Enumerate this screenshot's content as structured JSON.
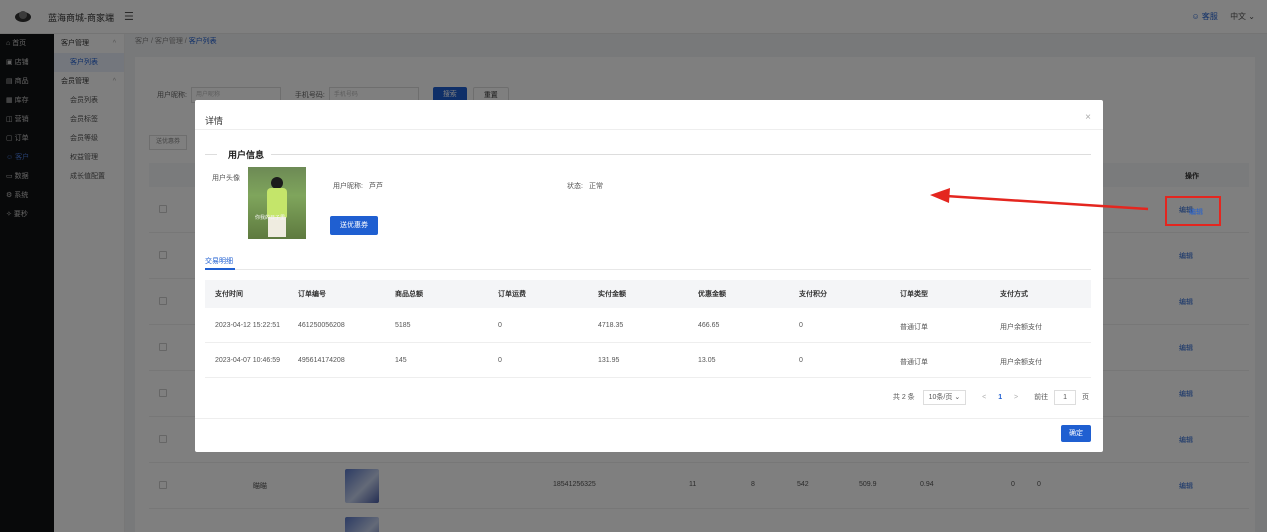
{
  "app": {
    "brand": "蓝海商城-商家端",
    "service": "客服",
    "language": "中文"
  },
  "sidebar": [
    {
      "icon": "home-icon",
      "label": "首页"
    },
    {
      "icon": "store-icon",
      "label": "店铺"
    },
    {
      "icon": "goods-icon",
      "label": "商品"
    },
    {
      "icon": "inventory-icon",
      "label": "库存"
    },
    {
      "icon": "marketing-icon",
      "label": "营销"
    },
    {
      "icon": "order-icon",
      "label": "订单"
    },
    {
      "icon": "customer-icon",
      "label": "客户",
      "active": true
    },
    {
      "icon": "data-icon",
      "label": "数据"
    },
    {
      "icon": "system-icon",
      "label": "系统"
    },
    {
      "icon": "help-icon",
      "label": "要秒"
    }
  ],
  "subsidebar": {
    "group1": "客户管理",
    "group1_items": [
      "客户列表"
    ],
    "group2": "会员管理",
    "group2_items": [
      "会员列表",
      "会员标签",
      "会员等级",
      "权益管理",
      "成长值配置"
    ]
  },
  "breadcrumb": {
    "items": [
      "客户",
      "客户管理",
      "客户列表"
    ]
  },
  "filters": {
    "nickname_label": "用户昵称:",
    "nickname_placeholder": "用户昵称",
    "phone_label": "手机号码:",
    "phone_placeholder": "手机号码",
    "search": "搜索",
    "reset": "重置"
  },
  "background": {
    "send_coupon": "送优惠券",
    "op_header": "操作",
    "edit": "编辑",
    "row_nickname": "瞄瞄",
    "row_phone": "18541256325",
    "row_values": [
      "11",
      "8",
      "542",
      "509.9",
      "0.94",
      "0",
      "0"
    ]
  },
  "dialog": {
    "title": "详情",
    "close": "×",
    "section": "用户信息",
    "avatar_label": "用户头像",
    "avatar_caption": "你我的日子里",
    "nickname_label": "用户昵称:",
    "nickname": "芦芦",
    "status_label": "状态:",
    "status": "正常",
    "coupon_button": "送优惠券",
    "tab": "交易明细",
    "columns": [
      "支付时间",
      "订单编号",
      "商品总额",
      "订单运费",
      "实付金额",
      "优惠金额",
      "支付积分",
      "订单类型",
      "支付方式"
    ],
    "rows": [
      [
        "2023-04-12 15:22:51",
        "461250056208",
        "5185",
        "0",
        "4718.35",
        "466.65",
        "0",
        "普通订单",
        "用户余额支付"
      ],
      [
        "2023-04-07 10:46:59",
        "495614174208",
        "145",
        "0",
        "131.95",
        "13.05",
        "0",
        "普通订单",
        "用户余额支付"
      ]
    ],
    "pager": {
      "total": "共 2 条",
      "page_size": "10条/页",
      "prev": "<",
      "page": "1",
      "next": ">",
      "goto_label": "前往",
      "goto_value": "1",
      "page_unit": "页"
    },
    "ok": "确定"
  },
  "colors": {
    "primary": "#1f5fd1",
    "annotation": "#e4261f"
  }
}
